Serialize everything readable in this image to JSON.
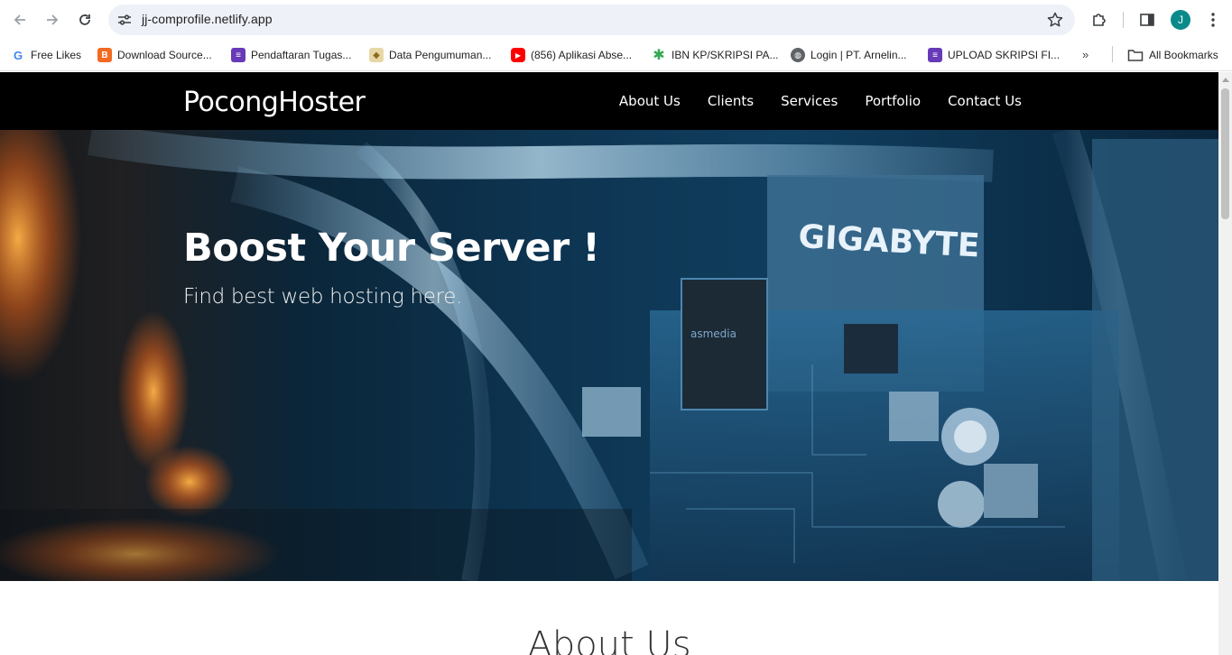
{
  "browser": {
    "url": "jj-comprofile.netlify.app",
    "profile_initial": "J",
    "bookmarks": [
      {
        "label": "Free Likes",
        "icon": "g-logo-icon",
        "color": "#4285f4"
      },
      {
        "label": "Download Source...",
        "icon": "blogger-icon",
        "color": "#f26a21"
      },
      {
        "label": "Pendaftaran Tugas...",
        "icon": "forms-icon",
        "color": "#673ab7"
      },
      {
        "label": "Data Pengumuman...",
        "icon": "folder-emblem-icon",
        "color": "#c9a74a"
      },
      {
        "label": "(856) Aplikasi Abse...",
        "icon": "youtube-icon",
        "color": "#ff0000"
      },
      {
        "label": "IBN KP/SKRIPSI PA...",
        "icon": "asterisk-icon",
        "color": "#34a853"
      },
      {
        "label": "Login | PT. Arnelin...",
        "icon": "globe-icon",
        "color": "#5f6368"
      },
      {
        "label": "UPLOAD SKRIPSI FI...",
        "icon": "forms-icon",
        "color": "#673ab7"
      }
    ],
    "more_label": "»",
    "all_bookmarks": "All Bookmarks"
  },
  "site": {
    "brand": "PocongHoster",
    "menu": [
      "About Us",
      "Clients",
      "Services",
      "Portfolio",
      "Contact Us"
    ],
    "hero": {
      "title": "Boost Your Server !",
      "subtitle": "Find best web hosting here.",
      "image_text": "GIGABYTE"
    },
    "about_heading": "About Us"
  }
}
